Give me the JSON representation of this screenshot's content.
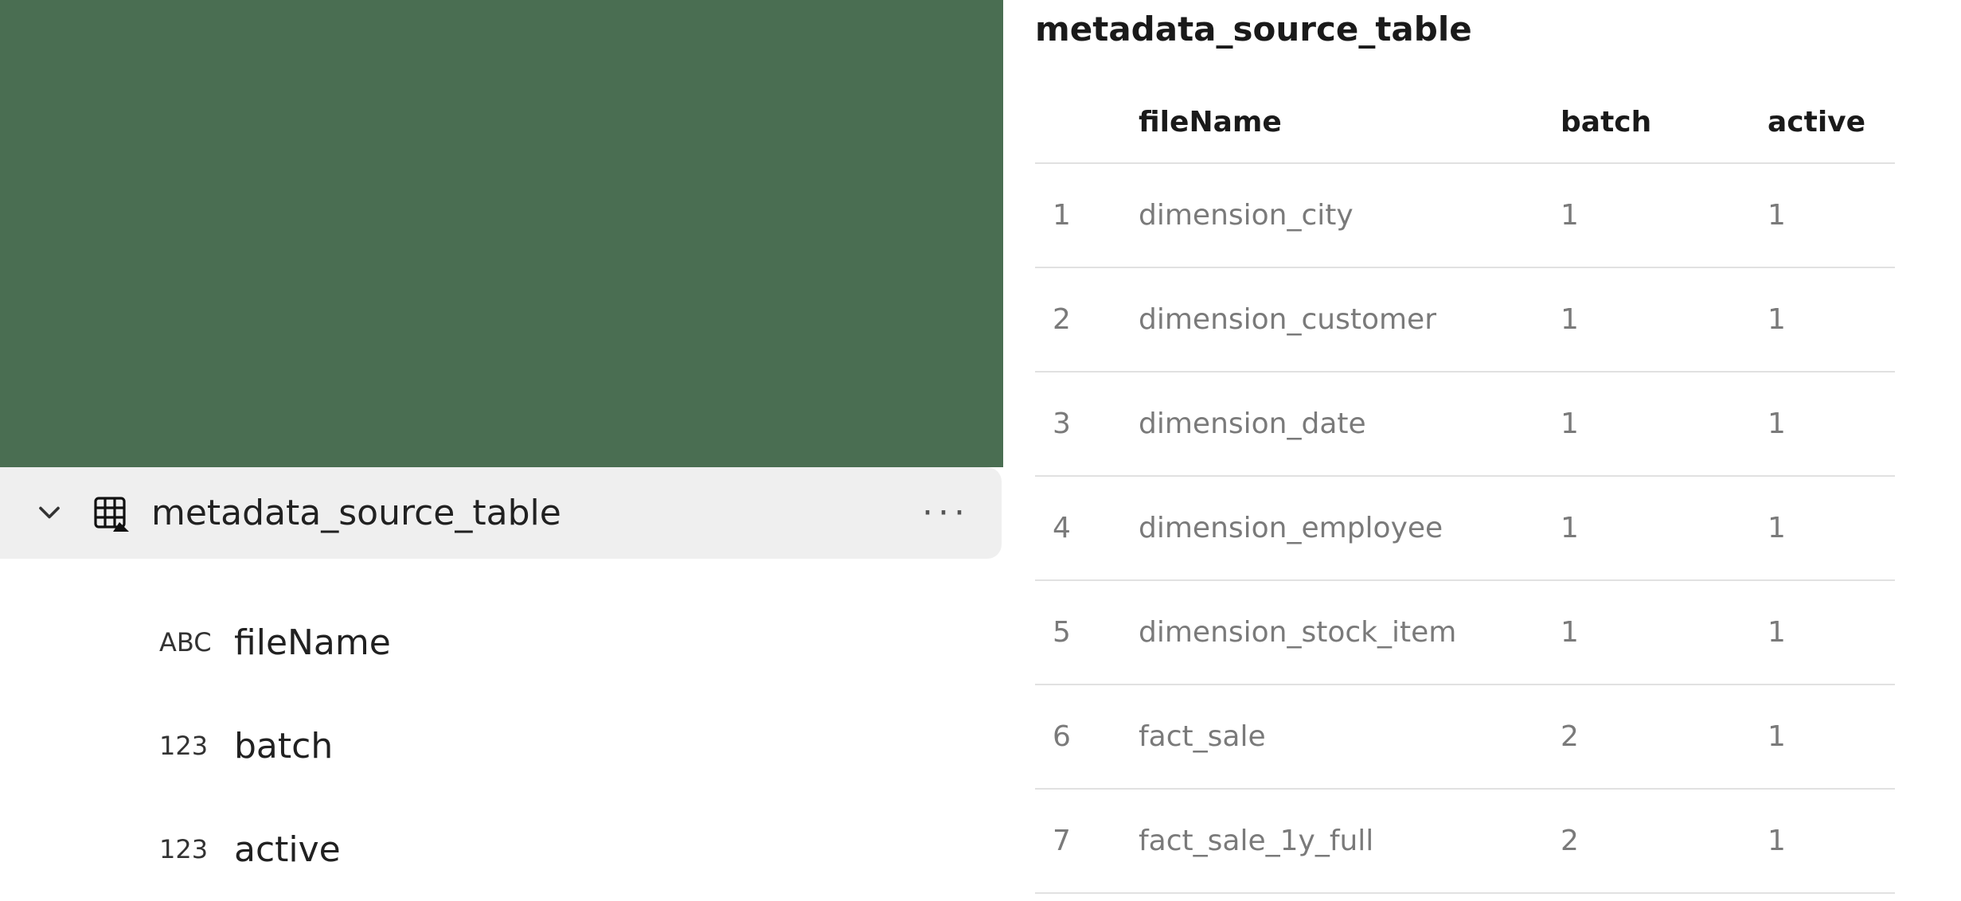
{
  "tree": {
    "table_name": "metadata_source_table",
    "more_glyph": "···",
    "columns": [
      {
        "type": "ABC",
        "name": "fileName"
      },
      {
        "type": "123",
        "name": "batch"
      },
      {
        "type": "123",
        "name": "active"
      }
    ]
  },
  "preview": {
    "title": "metadata_source_table",
    "headers": {
      "fileName": "fileName",
      "batch": "batch",
      "active": "active"
    },
    "rows": [
      {
        "idx": "1",
        "fileName": "dimension_city",
        "batch": "1",
        "active": "1"
      },
      {
        "idx": "2",
        "fileName": "dimension_customer",
        "batch": "1",
        "active": "1"
      },
      {
        "idx": "3",
        "fileName": "dimension_date",
        "batch": "1",
        "active": "1"
      },
      {
        "idx": "4",
        "fileName": "dimension_employee",
        "batch": "1",
        "active": "1"
      },
      {
        "idx": "5",
        "fileName": "dimension_stock_item",
        "batch": "1",
        "active": "1"
      },
      {
        "idx": "6",
        "fileName": "fact_sale",
        "batch": "2",
        "active": "1"
      },
      {
        "idx": "7",
        "fileName": "fact_sale_1y_full",
        "batch": "2",
        "active": "1"
      }
    ]
  }
}
